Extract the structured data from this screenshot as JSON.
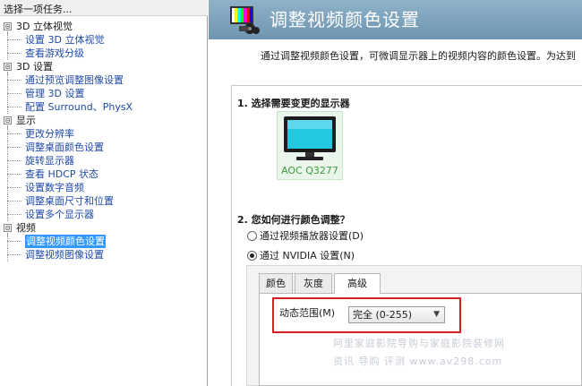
{
  "left_pane": {
    "header": "选择一项任务...",
    "categories": [
      {
        "label": "3D 立体视觉",
        "toggle": "⊟",
        "children": [
          "设置 3D 立体视觉",
          "查看游戏分级"
        ]
      },
      {
        "label": "3D 设置",
        "toggle": "⊟",
        "children": [
          "通过预览调整图像设置",
          "管理 3D 设置",
          "配置 Surround、PhysX"
        ]
      },
      {
        "label": "显示",
        "toggle": "⊟",
        "children": [
          "更改分辨率",
          "调整桌面颜色设置",
          "旋转显示器",
          "查看 HDCP 状态",
          "设置数字音频",
          "调整桌面尺寸和位置",
          "设置多个显示器"
        ]
      },
      {
        "label": "视频",
        "toggle": "⊟",
        "children": [
          "调整视频颜色设置",
          "调整视频图像设置"
        ]
      }
    ],
    "selected_item": "调整视频颜色设置"
  },
  "header": {
    "title": "调整视频颜色设置",
    "icon": "video-color-icon",
    "band_color": "#7ea3bd"
  },
  "description": "通过调整视频颜色设置，可微调显示器上的视频内容的颜色设置。为达到",
  "section1": {
    "title": "1. 选择需要变更的显示器",
    "display_name": "AOC Q3277",
    "display_label_color": "#3c9b3c"
  },
  "section2": {
    "title": "2. 您如何进行颜色调整？",
    "options": [
      {
        "label": "通过视频播放器设置(D)",
        "checked": false
      },
      {
        "label": "通过 NVIDIA 设置(N)",
        "checked": true
      }
    ]
  },
  "tabs": [
    {
      "label": "颜色",
      "active": false
    },
    {
      "label": "灰度",
      "active": false
    },
    {
      "label": "高级",
      "active": true
    }
  ],
  "dynamic_range": {
    "label": "动态范围(M)",
    "value": "完全 (0-255)",
    "highlight_color": "#d42020"
  },
  "watermark": {
    "line1": "阿里家庭影院导购与家庭影院装修网",
    "line2": "资讯 导购 评测 www.av298.com"
  }
}
